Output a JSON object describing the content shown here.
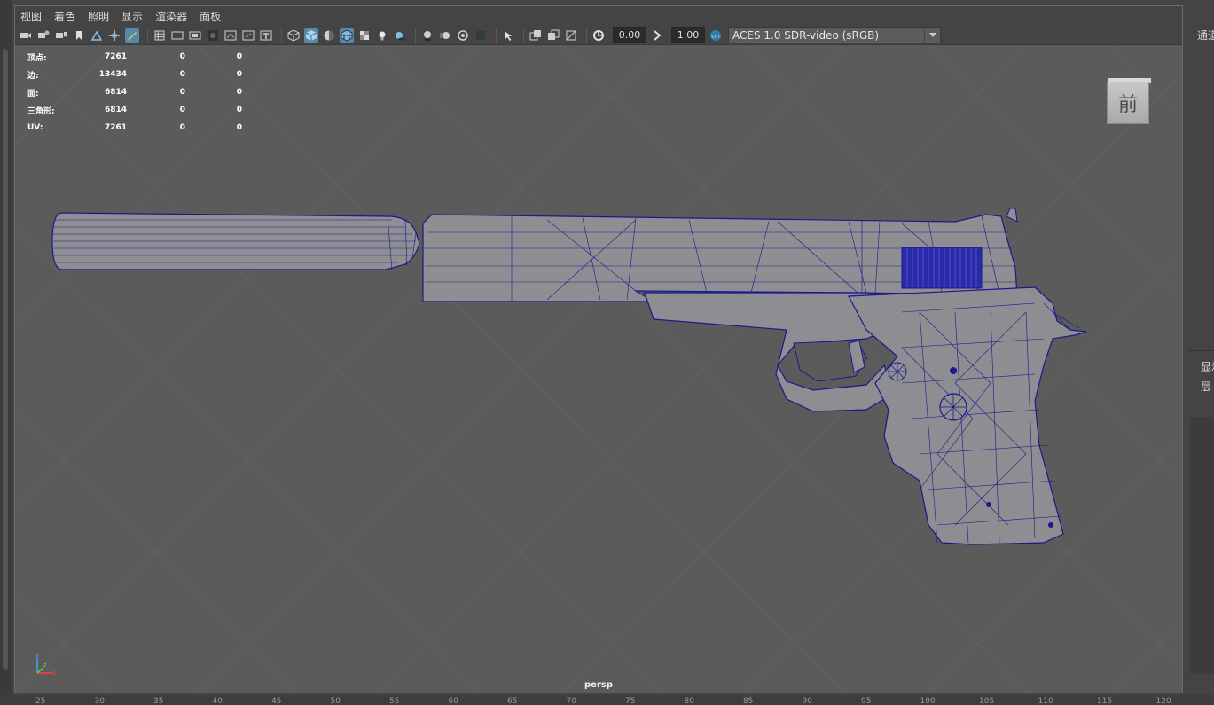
{
  "menu": [
    "视图",
    "着色",
    "照明",
    "显示",
    "渲染器",
    "面板"
  ],
  "toolbar": {
    "exposure_value": "0.00",
    "gamma_value": "1.00",
    "color_transform": "ACES 1.0 SDR-video (sRGB)",
    "icons_group1": [
      "camera-select-icon",
      "camera-attributes-icon",
      "bookmark-icon",
      "image-plane-icon",
      "2d-pan-zoom-icon",
      "grease-pencil-icon"
    ],
    "icons_group2": [
      "grid-icon",
      "film-gate-icon",
      "resolution-gate-icon",
      "gate-mask-icon",
      "field-chart-icon",
      "safe-action-icon",
      "safe-title-icon"
    ],
    "icons_group3": [
      "wireframe-icon",
      "smooth-shade-icon",
      "default-material-icon",
      "wireframe-on-shaded-icon",
      "textured-icon",
      "lights-icon",
      "shadows-icon"
    ],
    "icons_group4": [
      "ambient-occlusion-icon",
      "motion-blur-icon",
      "anti-alias-icon",
      "depth-of-field-icon",
      "isolate-select-icon",
      "xray-icon"
    ],
    "icons_group5": [
      "xray-joints-icon",
      "xray-active-icon",
      "backface-cull-icon"
    ]
  },
  "hud": {
    "rows": [
      {
        "label": "顶点:",
        "v1": "7261",
        "v2": "0",
        "v3": "0"
      },
      {
        "label": "边:",
        "v1": "13434",
        "v2": "0",
        "v3": "0"
      },
      {
        "label": "面:",
        "v1": "6814",
        "v2": "0",
        "v3": "0"
      },
      {
        "label": "三角形:",
        "v1": "6814",
        "v2": "0",
        "v3": "0"
      },
      {
        "label": "UV:",
        "v1": "7261",
        "v2": "0",
        "v3": "0"
      }
    ]
  },
  "viewcube_label": "前",
  "camera_name": "persp",
  "right_panel": {
    "top_label": "通道",
    "mid_label_1": "显示",
    "mid_label_2": "层"
  },
  "ruler_ticks": [
    "25",
    "30",
    "35",
    "40",
    "45",
    "50",
    "55",
    "60",
    "65",
    "70",
    "75",
    "80",
    "85",
    "90",
    "95",
    "100",
    "105",
    "110",
    "115",
    "120"
  ],
  "colors": {
    "wire": "#1a1a8c",
    "mesh_fill": "#8f8f93",
    "viewport_bg": "#5b5b5b",
    "active_icon": "#5a86a8"
  }
}
